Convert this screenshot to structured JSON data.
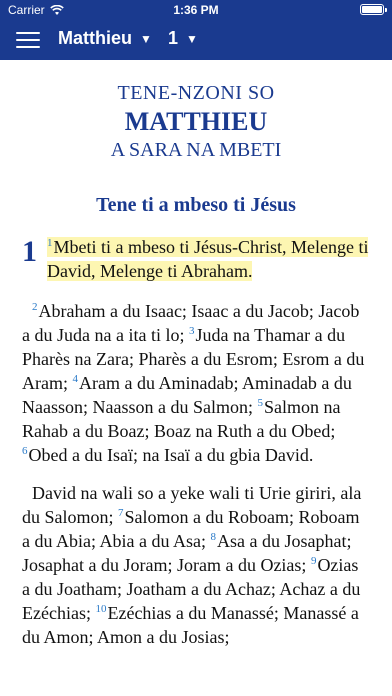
{
  "status": {
    "carrier": "Carrier",
    "time": "1:36 PM"
  },
  "nav": {
    "book": "Matthieu",
    "chapter": "1"
  },
  "header": {
    "sup_title": "TENE-NZONI SO",
    "main_title": "MATTHIEU",
    "sub_title": "A SARA NA MBETI"
  },
  "section_heading": "Tene ti a mbeso ti Jésus",
  "chapter_number": "1",
  "verses": {
    "v1": {
      "num": "1",
      "text": "Mbeti ti a mbeso ti Jésus-Christ, Melenge ti David, Melenge ti Abraham."
    },
    "v2": {
      "num": "2",
      "text": "Abraham a du Isaac; Isaac a du Jacob; Jacob a du Juda na a ita ti lo; "
    },
    "v3": {
      "num": "3",
      "text": "Juda na Thamar a du Pharès na Zara; Pharès a du Esrom; Esrom a du Aram; "
    },
    "v4": {
      "num": "4",
      "text": "Aram a du Aminadab; Aminadab a du Naasson; Naasson a du Salmon; "
    },
    "v5": {
      "num": "5",
      "text": "Salmon na Rahab a du Boaz; Boaz na Ruth a du Obed; "
    },
    "v6": {
      "num": "6",
      "text": "Obed a du Isaï; na Isaï a du gbia David."
    },
    "v6b": {
      "text": "David na wali so a yeke wali ti Urie giriri, ala du Salomon; "
    },
    "v7": {
      "num": "7",
      "text": "Salomon a du Roboam; Roboam a du Abia; Abia a du Asa; "
    },
    "v8": {
      "num": "8",
      "text": "Asa a du Josaphat; Josaphat a du Joram; Joram a du Ozias; "
    },
    "v9": {
      "num": "9",
      "text": "Ozias a du Joatham; Joatham a du Achaz; Achaz a du Ezéchias; "
    },
    "v10": {
      "num": "10",
      "text": "Ezéchias a du Manassé; Manassé a du Amon; Amon a du Josias;"
    }
  },
  "colors": {
    "bar": "#1a3a8f",
    "title": "#1a3a8f",
    "verse_number": "#2a7ac8",
    "highlight": "#fdf6b2"
  },
  "icons": {
    "menu": "hamburger-icon",
    "wifi": "wifi-icon",
    "battery": "battery-icon",
    "caret": "caret-down-icon"
  }
}
